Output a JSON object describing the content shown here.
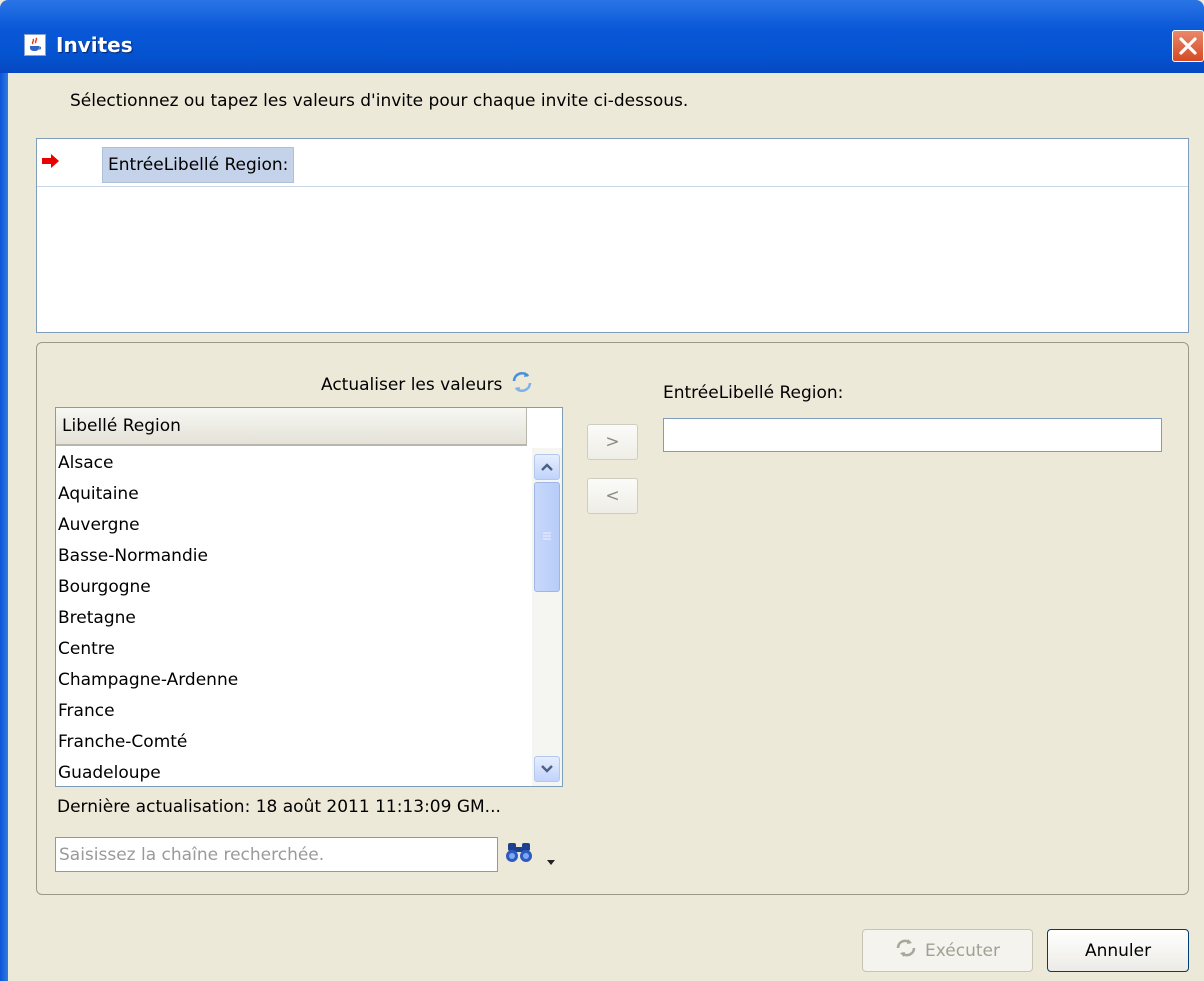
{
  "window": {
    "title": "Invites",
    "app_icon": "java-icon",
    "close_icon": "close-icon"
  },
  "instruction": "Sélectionnez ou tapez les valeurs d'invite pour chaque invite ci-dessous.",
  "prompt_list": {
    "rows": [
      {
        "label": "EntréeLibellé Region:",
        "indicator_icon": "red-arrow-icon"
      }
    ]
  },
  "lov": {
    "refresh_label": "Actualiser les valeurs",
    "refresh_icon": "refresh-icon",
    "column_header": "Libellé Region",
    "items": [
      "Alsace",
      "Aquitaine",
      "Auvergne",
      "Basse-Normandie",
      "Bourgogne",
      "Bretagne",
      "Centre",
      "Champagne-Ardenne",
      "France",
      "Franche-Comté",
      "Guadeloupe"
    ],
    "last_update": "Dernière actualisation: 18 août 2011 11:13:09 GM...",
    "search_placeholder": "Saisissez la chaîne recherchée.",
    "search_icon": "binoculars-icon"
  },
  "transfer": {
    "add_label": ">",
    "remove_label": "<"
  },
  "selected_values": {
    "label": "EntréeLibellé Region:",
    "value": ""
  },
  "footer": {
    "run_label": "Exécuter",
    "cancel_label": "Annuler"
  },
  "colors": {
    "titlebar": "#0453d0",
    "dialog_bg": "#ece9d8",
    "selection": "#c4d3ea",
    "close_button": "#d54b24"
  }
}
